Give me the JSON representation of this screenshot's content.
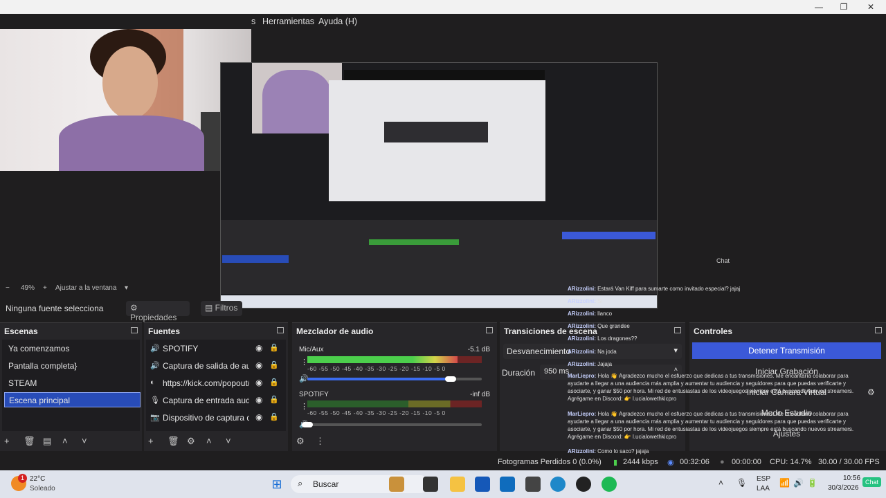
{
  "window": {
    "controls": [
      "—",
      "❐",
      "✕"
    ]
  },
  "menu": {
    "partial_item": "s",
    "items": [
      "Herramientas",
      "Ayuda (H)"
    ]
  },
  "preview": {
    "chat_label": "Chat"
  },
  "zoom": {
    "minus": "−",
    "value": "49%",
    "plus": "+",
    "fit_label": "Ajustar a la ventana"
  },
  "selection": {
    "status": "Ninguna fuente selecciona",
    "properties_label": "Propiedades",
    "filters_label": "Filtros"
  },
  "scenes": {
    "title": "Escenas",
    "items": [
      "Ya comenzamos",
      "Pantalla completa}",
      "STEAM",
      "Escena principal"
    ],
    "selected_index": 3
  },
  "sources": {
    "title": "Fuentes",
    "items": [
      {
        "label": "SPOTIFY",
        "icon": "speaker-icon"
      },
      {
        "label": "Captura de salida de audio",
        "icon": "speaker-icon"
      },
      {
        "label": "https://kick.com/popout/",
        "icon": "browser-icon"
      },
      {
        "label": "Captura de entrada audio",
        "icon": "mic-icon"
      },
      {
        "label": "Dispositivo de captura de video",
        "icon": "camera-icon"
      }
    ]
  },
  "mixer": {
    "title": "Mezclador de audio",
    "channels": [
      {
        "name": "Mic/Aux",
        "db": "-5.1 dB",
        "level": 0.86,
        "volume": 0.82
      },
      {
        "name": "SPOTIFY",
        "db": "-inf dB",
        "level": 0.0,
        "volume": 0.0
      }
    ],
    "scale": "-60  -55  -50  -45  -40  -35  -30  -25  -20  -15  -10   -5    0"
  },
  "transitions": {
    "title": "Transiciones de escena",
    "selected": "Desvanecimiento",
    "duration_label": "Duración",
    "duration_value": "950 ms"
  },
  "controls": {
    "title": "Controles",
    "stop_stream": "Detener Transmisión",
    "start_recording": "Iniciar Grabación",
    "virtual_camera": "Iniciar Cámara Virtual",
    "studio_mode": "Modo Estudio",
    "settings": "Ajustes"
  },
  "chat": {
    "messages": [
      {
        "user": "ARizzolini:",
        "text": " Estará Van Kiff para sumarte como invitado especial? jajaj"
      },
      {
        "user": "ARizzolini:",
        "text": " Si"
      },
      {
        "user": "ARizzolini:",
        "text": " llanco"
      },
      {
        "user": "ARizzolini:",
        "text": " Que grandee"
      },
      {
        "user": "ARizzolini:",
        "text": " Los dragones??"
      },
      {
        "user": "ARizzolini:",
        "text": " Na joda"
      },
      {
        "user": "ARizzolini:",
        "text": " Jajaja"
      },
      {
        "user": "MarLiepro:",
        "text": " Hola 👋 Agradezco mucho el esfuerzo que dedicas a tus transmisiones. Me encantaría colaborar para ayudarte a llegar a una audiencia más amplia y aumentar tu audiencia y seguidores para que puedas verificarte y asociarte, y ganar $50 por hora. Mi red de entusiastas de los videojuegos siempre está buscando nuevos streamers. Agrégame en Discord: 👉 l.ucialowethkicpro"
      },
      {
        "user": "MarLiepro:",
        "text": " Hola 👋 Agradezco mucho el esfuerzo que dedicas a tus transmisiones. Me encantaría colaborar para ayudarte a llegar a una audiencia más amplia y aumentar tu audiencia y seguidores para que puedas verificarte y asociarte, y ganar $50 por hora. Mi red de entusiastas de los videojuegos siempre está buscando nuevos streamers. Agrégame en Discord: 👉 l.ucialowethkicpro"
      },
      {
        "user": "ARizzolini:",
        "text": " Como lo saco? jajaja"
      }
    ]
  },
  "status": {
    "dropped_frames": "Fotogramas Perdidos 0 (0.0%)",
    "bitrate": "2444 kbps",
    "stream_time": "00:32:06",
    "record_time": "00:00:00",
    "cpu": "CPU: 14.7%",
    "fps": "30.00 / 30.00 FPS"
  },
  "taskbar": {
    "weather_temp": "22°C",
    "weather_desc": "Soleado",
    "notification_count": "1",
    "search_label": "Buscar",
    "lang_line1": "ESP",
    "lang_line2": "LAA",
    "time": "10:56",
    "date": "30/3/2026",
    "chat_badge": "Chat"
  },
  "colors": {
    "accent": "#284cb8",
    "stream_button": "#3b59d8",
    "panel": "#272629",
    "background": "#1f1e1f"
  }
}
